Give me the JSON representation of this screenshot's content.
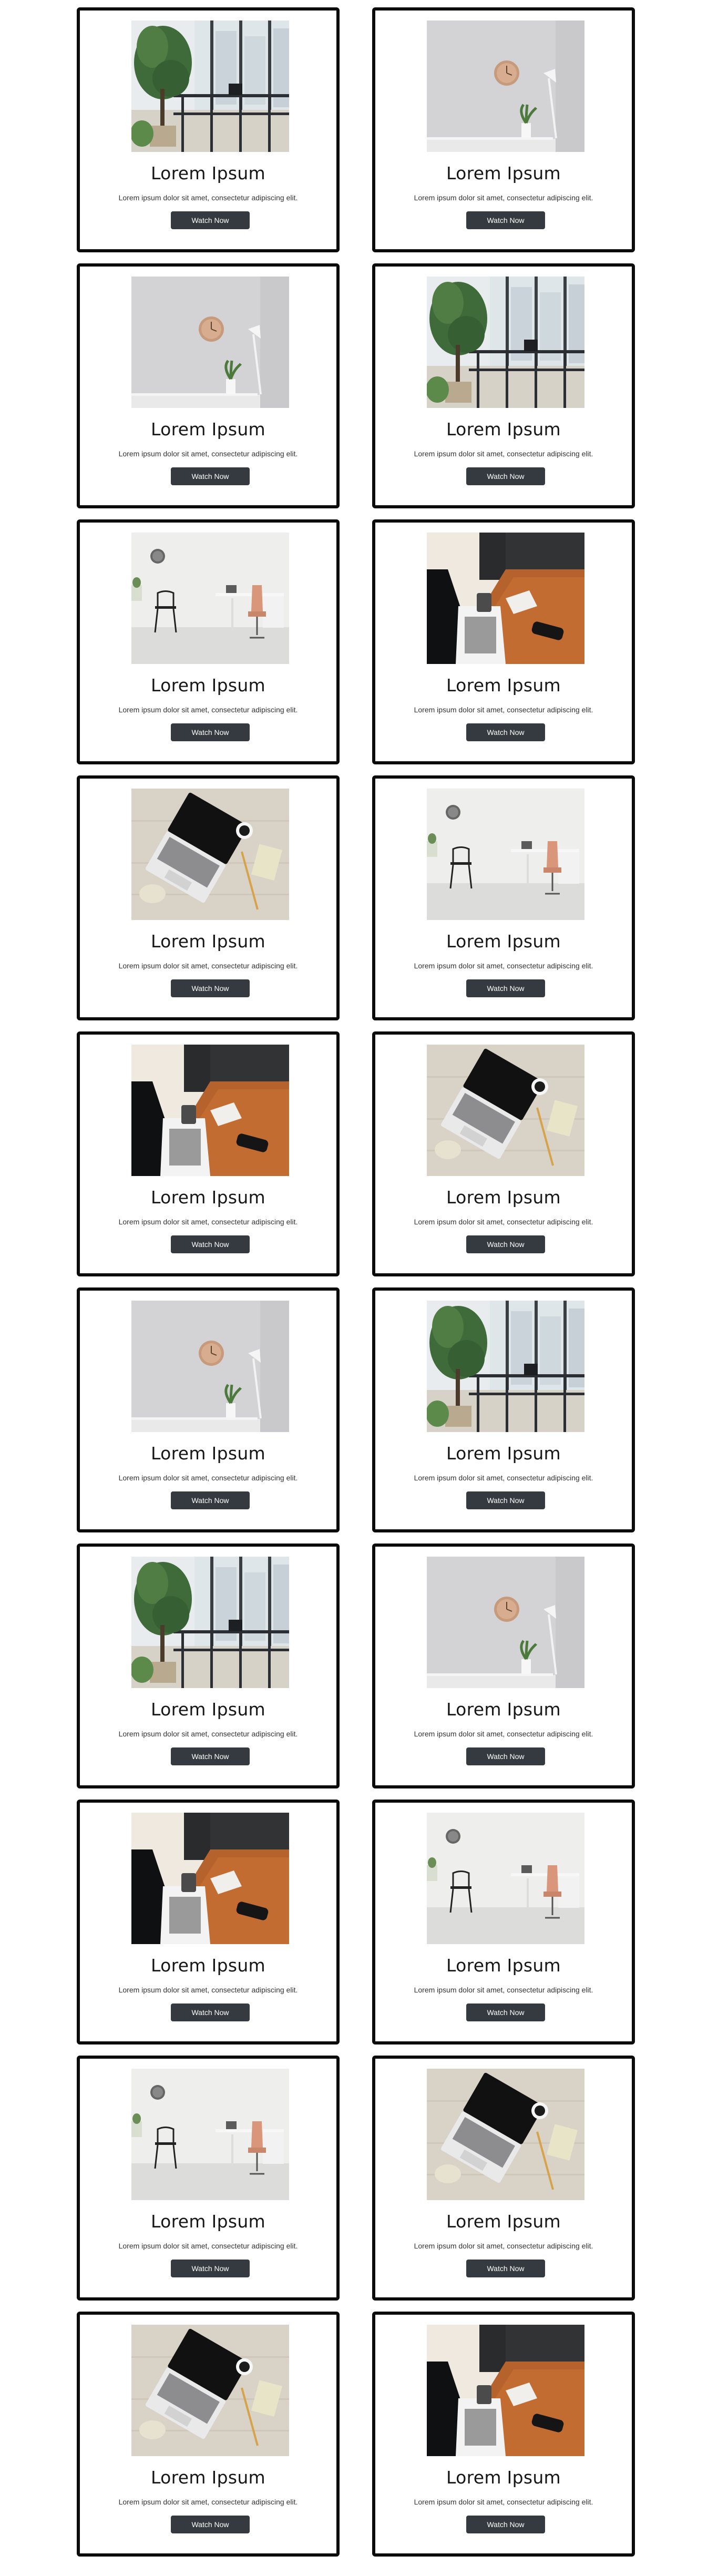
{
  "cards": [
    {
      "title": "Lorem Ipsum",
      "description": "Lorem ipsum dolor sit amet, consectetur adipiscing elit.",
      "button_label": "Watch Now",
      "image": "balcony-plants"
    },
    {
      "title": "Lorem Ipsum",
      "description": "Lorem ipsum dolor sit amet, consectetur adipiscing elit.",
      "button_label": "Watch Now",
      "image": "wall-clock-desk"
    },
    {
      "title": "Lorem Ipsum",
      "description": "Lorem ipsum dolor sit amet, consectetur adipiscing elit.",
      "button_label": "Watch Now",
      "image": "wall-clock-desk"
    },
    {
      "title": "Lorem Ipsum",
      "description": "Lorem ipsum dolor sit amet, consectetur adipiscing elit.",
      "button_label": "Watch Now",
      "image": "balcony-plants"
    },
    {
      "title": "Lorem Ipsum",
      "description": "Lorem ipsum dolor sit amet, consectetur adipiscing elit.",
      "button_label": "Watch Now",
      "image": "white-office"
    },
    {
      "title": "Lorem Ipsum",
      "description": "Lorem ipsum dolor sit amet, consectetur adipiscing elit.",
      "button_label": "Watch Now",
      "image": "wooden-desk"
    },
    {
      "title": "Lorem Ipsum",
      "description": "Lorem ipsum dolor sit amet, consectetur adipiscing elit.",
      "button_label": "Watch Now",
      "image": "laptop-top"
    },
    {
      "title": "Lorem Ipsum",
      "description": "Lorem ipsum dolor sit amet, consectetur adipiscing elit.",
      "button_label": "Watch Now",
      "image": "white-office"
    },
    {
      "title": "Lorem Ipsum",
      "description": "Lorem ipsum dolor sit amet, consectetur adipiscing elit.",
      "button_label": "Watch Now",
      "image": "wooden-desk"
    },
    {
      "title": "Lorem Ipsum",
      "description": "Lorem ipsum dolor sit amet, consectetur adipiscing elit.",
      "button_label": "Watch Now",
      "image": "laptop-top"
    },
    {
      "title": "Lorem Ipsum",
      "description": "Lorem ipsum dolor sit amet, consectetur adipiscing elit.",
      "button_label": "Watch Now",
      "image": "wall-clock-desk"
    },
    {
      "title": "Lorem Ipsum",
      "description": "Lorem ipsum dolor sit amet, consectetur adipiscing elit.",
      "button_label": "Watch Now",
      "image": "balcony-plants"
    },
    {
      "title": "Lorem Ipsum",
      "description": "Lorem ipsum dolor sit amet, consectetur adipiscing elit.",
      "button_label": "Watch Now",
      "image": "balcony-plants"
    },
    {
      "title": "Lorem Ipsum",
      "description": "Lorem ipsum dolor sit amet, consectetur adipiscing elit.",
      "button_label": "Watch Now",
      "image": "wall-clock-desk"
    },
    {
      "title": "Lorem Ipsum",
      "description": "Lorem ipsum dolor sit amet, consectetur adipiscing elit.",
      "button_label": "Watch Now",
      "image": "wooden-desk"
    },
    {
      "title": "Lorem Ipsum",
      "description": "Lorem ipsum dolor sit amet, consectetur adipiscing elit.",
      "button_label": "Watch Now",
      "image": "white-office"
    },
    {
      "title": "Lorem Ipsum",
      "description": "Lorem ipsum dolor sit amet, consectetur adipiscing elit.",
      "button_label": "Watch Now",
      "image": "white-office"
    },
    {
      "title": "Lorem Ipsum",
      "description": "Lorem ipsum dolor sit amet, consectetur adipiscing elit.",
      "button_label": "Watch Now",
      "image": "laptop-top"
    },
    {
      "title": "Lorem Ipsum",
      "description": "Lorem ipsum dolor sit amet, consectetur adipiscing elit.",
      "button_label": "Watch Now",
      "image": "laptop-top"
    },
    {
      "title": "Lorem Ipsum",
      "description": "Lorem ipsum dolor sit amet, consectetur adipiscing elit.",
      "button_label": "Watch Now",
      "image": "wooden-desk"
    }
  ]
}
